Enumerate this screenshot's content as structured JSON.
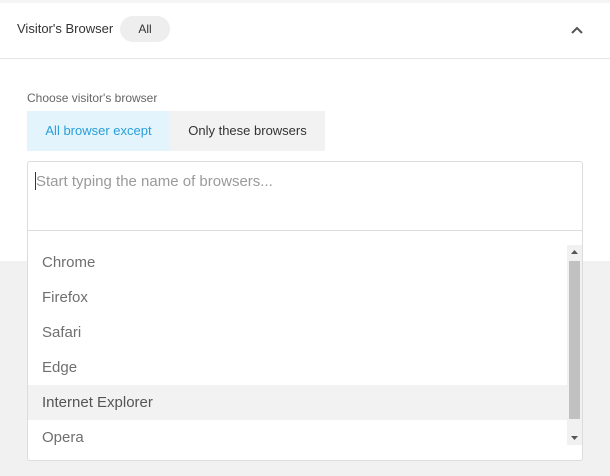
{
  "header": {
    "title": "Visitor's Browser",
    "badge": "All",
    "collapse_icon": "chevron-up-icon"
  },
  "filter": {
    "label": "Choose visitor's browser",
    "modes": [
      {
        "label": "All browser except",
        "selected": true
      },
      {
        "label": "Only these browsers",
        "selected": false
      }
    ]
  },
  "search": {
    "placeholder": "Start typing the name of browsers...",
    "value": ""
  },
  "dropdown": {
    "options": [
      "Chrome",
      "Firefox",
      "Safari",
      "Edge",
      "Internet Explorer",
      "Opera"
    ],
    "highlighted": "Internet Explorer"
  },
  "colors": {
    "accent": "#2a9fd8",
    "accent_bg": "#e3f4fc",
    "highlight_bg": "#f2f2f2"
  }
}
